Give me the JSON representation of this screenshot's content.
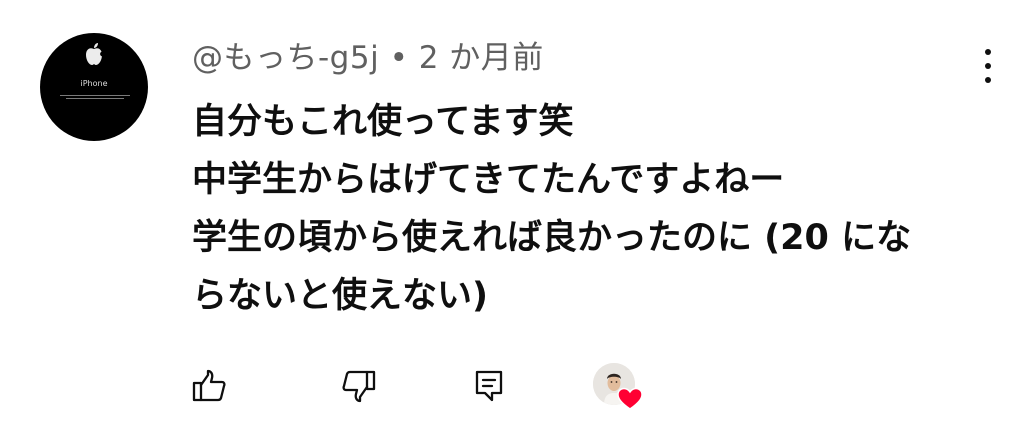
{
  "comment": {
    "author": "@もっち-g5j",
    "separator": "•",
    "time_ago": "2 か月前",
    "lines": [
      "自分もこれ使ってます笑",
      "中学生からはげてきてたんですよねー",
      "学生の頃から使えれば良かったのに (20 にな",
      "らないと使えない)"
    ]
  },
  "avatar": {
    "brand_text": "iPhone",
    "icon": "apple-logo"
  },
  "actions": {
    "like_icon": "thumbs-up-icon",
    "dislike_icon": "thumbs-down-icon",
    "reply_icon": "comment-reply-icon",
    "creator_heart_icon": "heart-icon",
    "heart_color": "#ff0033"
  }
}
